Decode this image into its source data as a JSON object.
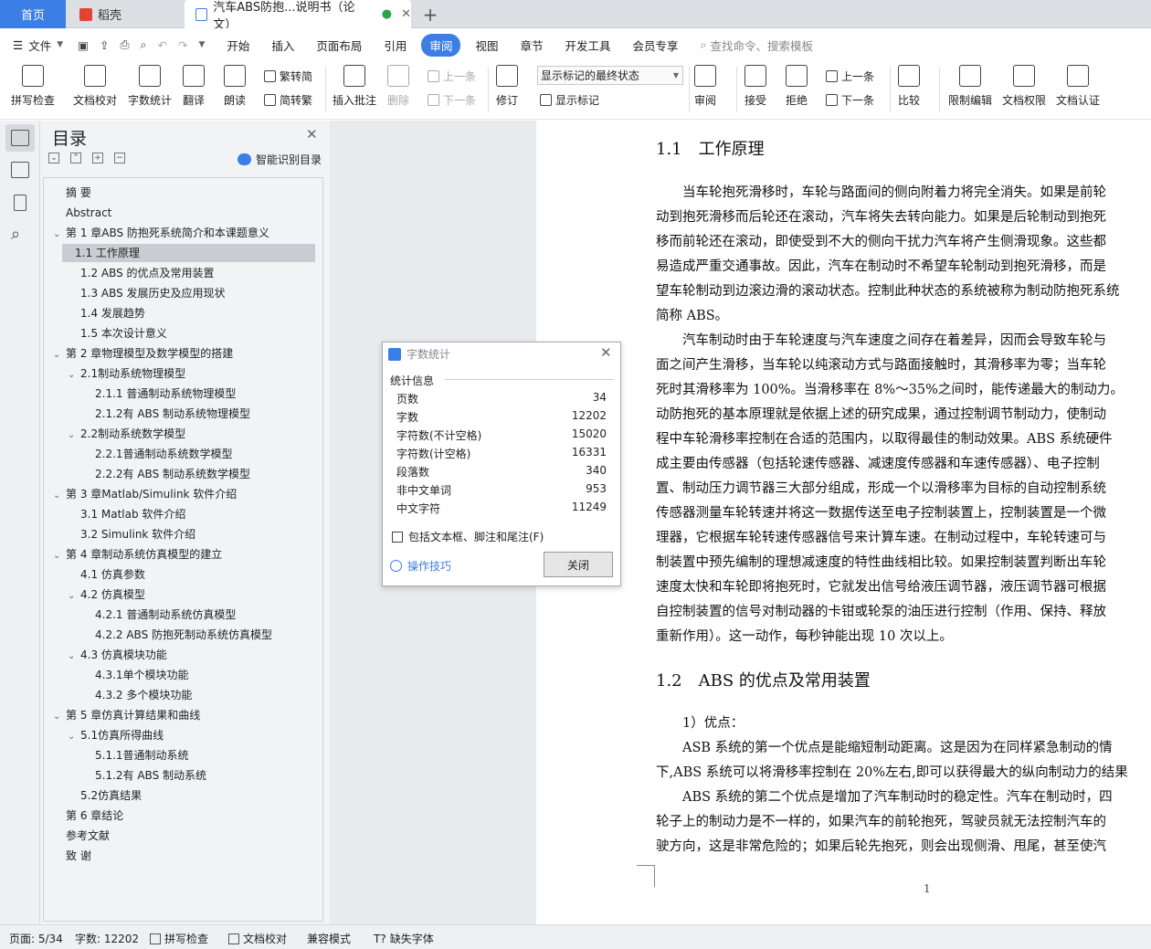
{
  "tabs": {
    "home": "首页",
    "daoke": "稻壳",
    "doc": "汽车ABS防抱...说明书（论文）"
  },
  "menu": {
    "file": "文件",
    "items": [
      "开始",
      "插入",
      "页面布局",
      "引用",
      "审阅",
      "视图",
      "章节",
      "开发工具",
      "会员专享"
    ],
    "active": "审阅",
    "search": "查找命令、搜索模板"
  },
  "toolbar": {
    "spell": "拼写检查",
    "proof": "文档校对",
    "count": "字数统计",
    "translate": "翻译",
    "read": "朗读",
    "trad": "繁转简",
    "simp": "简转繁",
    "insert_comment": "插入批注",
    "delete": "删除",
    "prev": "上一条",
    "next": "下一条",
    "revise": "修订",
    "track_select": "显示标记的最终状态",
    "show_marks": "显示标记",
    "review": "审阅",
    "accept": "接受",
    "reject": "拒绝",
    "prev2": "上一条",
    "next2": "下一条",
    "compare": "比较",
    "restrict": "限制编辑",
    "rights": "文档权限",
    "auth": "文档认证"
  },
  "toc": {
    "title": "目录",
    "smart": "智能识别目录",
    "items": [
      "摘 要",
      "Abstract",
      "第 1 章ABS 防抱死系统简介和本课题意义",
      "1.1 工作原理",
      "1.2 ABS 的优点及常用装置",
      "1.3 ABS 发展历史及应用现状",
      "1.4 发展趋势",
      "1.5 本次设计意义",
      "第 2 章物理模型及数学模型的搭建",
      "2.1制动系统物理模型",
      "2.1.1 普通制动系统物理模型",
      "2.1.2有 ABS 制动系统物理模型",
      "2.2制动系统数学模型",
      "2.2.1普通制动系统数学模型",
      "2.2.2有 ABS 制动系统数学模型",
      "第 3 章Matlab/Simulink 软件介绍",
      "3.1 Matlab 软件介绍",
      "3.2 Simulink 软件介绍",
      "第 4 章制动系统仿真模型的建立",
      "4.1 仿真参数",
      "4.2 仿真模型",
      "4.2.1 普通制动系统仿真模型",
      "4.2.2 ABS 防抱死制动系统仿真模型",
      "4.3 仿真模块功能",
      "4.3.1单个模块功能",
      "4.3.2 多个模块功能",
      "第 5 章仿真计算结果和曲线",
      "5.1仿真所得曲线",
      "5.1.1普通制动系统",
      "5.1.2有 ABS 制动系统",
      "5.2仿真结果",
      "第 6 章结论",
      "参考文献",
      "致 谢"
    ]
  },
  "doc": {
    "h1": "1.1　工作原理",
    "p1": [
      "　　当车轮抱死滑移时，车轮与路面间的侧向附着力将完全消失。如果是前轮",
      "动到抱死滑移而后轮还在滚动，汽车将失去转向能力。如果是后轮制动到抱死",
      "移而前轮还在滚动，即使受到不大的侧向干扰力汽车将产生侧滑现象。这些都",
      "易造成严重交通事故。因此，汽车在制动时不希望车轮制动到抱死滑移，而是",
      "望车轮制动到边滚边滑的滚动状态。控制此种状态的系统被称为制动防抱死系统",
      "简称 ABS。",
      "　　汽车制动时由于车轮速度与汽车速度之间存在着差异，因而会导致车轮与",
      "面之间产生滑移，当车轮以纯滚动方式与路面接触时，其滑移率为零；当车轮",
      "死时其滑移率为 100%。当滑移率在 8%～35%之间时，能传递最大的制动力。",
      "动防抱死的基本原理就是依据上述的研究成果，通过控制调节制动力，使制动",
      "程中车轮滑移率控制在合适的范围内，以取得最佳的制动效果。ABS 系统硬件",
      "成主要由传感器（包括轮速传感器、减速度传感器和车速传感器）、电子控制",
      "置、制动压力调节器三大部分组成，形成一个以滑移率为目标的自动控制系统",
      "传感器测量车轮转速并将这一数据传送至电子控制装置上，控制装置是一个微",
      "理器，它根据车轮转速传感器信号来计算车速。在制动过程中，车轮转速可与",
      "制装置中预先编制的理想减速度的特性曲线相比较。如果控制装置判断出车轮",
      "速度太快和车轮即将抱死时，它就发出信号给液压调节器，液压调节器可根据",
      "自控制装置的信号对制动器的卡钳或轮泵的油压进行控制（作用、保持、释放",
      "重新作用）。这一动作，每秒钟能出现 10 次以上。"
    ],
    "h2": "1.2　ABS 的优点及常用装置",
    "p2": [
      "　　1）优点：",
      "　　ASB 系统的第一个优点是能缩短制动距离。这是因为在同样紧急制动的情",
      "下,ABS 系统可以将滑移率控制在 20%左右,即可以获得最大的纵向制动力的结果",
      "　　ABS 系统的第二个优点是增加了汽车制动时的稳定性。汽车在制动时，四",
      "轮子上的制动力是不一样的，如果汽车的前轮抱死，驾驶员就无法控制汽车的",
      "驶方向，这是非常危险的；如果后轮先抱死，则会出现侧滑、甩尾，甚至使汽"
    ],
    "page_number": "1"
  },
  "dialog": {
    "title": "字数统计",
    "section": "统计信息",
    "rows": [
      {
        "label": "页数",
        "value": "34"
      },
      {
        "label": "字数",
        "value": "12202"
      },
      {
        "label": "字符数(不计空格)",
        "value": "15020"
      },
      {
        "label": "字符数(计空格)",
        "value": "16331"
      },
      {
        "label": "段落数",
        "value": "340"
      },
      {
        "label": "非中文单词",
        "value": "953"
      },
      {
        "label": "中文字符",
        "value": "11249"
      }
    ],
    "checkbox": "包括文本框、脚注和尾注(F)",
    "tips": "操作技巧",
    "close": "关闭"
  },
  "status": {
    "page": "页面: 5/34",
    "words": "字数: 12202",
    "spell": "拼写检查",
    "proof": "文档校对",
    "compat": "兼容模式",
    "font": "缺失字体"
  },
  "colors": {
    "accent": "#3b7ee5",
    "selected_toc": "#c9cdd3"
  }
}
